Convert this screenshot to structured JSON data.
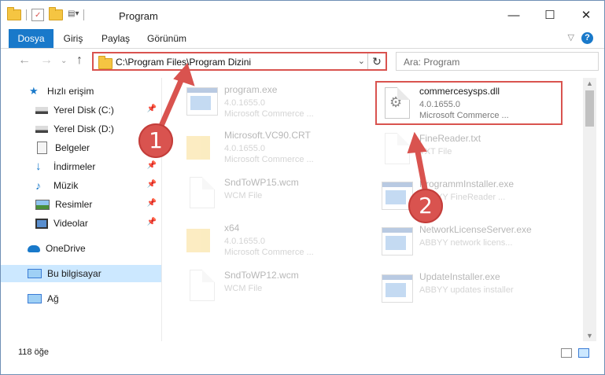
{
  "window": {
    "title": "Program",
    "controls": [
      "minimize",
      "maximize",
      "close"
    ]
  },
  "ribbon": {
    "tabs": [
      "Dosya",
      "Giriş",
      "Paylaş",
      "Görünüm"
    ]
  },
  "navigation": {
    "address_path": "C:\\Program Files\\Program Dizini",
    "search_placeholder": "Ara: Program"
  },
  "sidebar": {
    "items": [
      {
        "label": "Hızlı erişim",
        "icon": "star-icon",
        "pinned": false
      },
      {
        "label": "Yerel Disk (C:)",
        "icon": "drive-icon",
        "pinned": true
      },
      {
        "label": "Yerel Disk (D:)",
        "icon": "drive-icon",
        "pinned": false
      },
      {
        "label": "Belgeler",
        "icon": "documents-icon",
        "pinned": true
      },
      {
        "label": "İndirmeler",
        "icon": "download-icon",
        "pinned": true
      },
      {
        "label": "Müzik",
        "icon": "music-icon",
        "pinned": true
      },
      {
        "label": "Resimler",
        "icon": "pictures-icon",
        "pinned": true
      },
      {
        "label": "Videolar",
        "icon": "videos-icon",
        "pinned": true
      },
      {
        "label": "OneDrive",
        "icon": "cloud-icon",
        "pinned": false
      },
      {
        "label": "Bu bilgisayar",
        "icon": "computer-icon",
        "pinned": false,
        "selected": true
      },
      {
        "label": "Ağ",
        "icon": "network-icon",
        "pinned": false
      }
    ]
  },
  "files": [
    {
      "name": "program.exe",
      "line2": "4.0.1655.0",
      "line3": "Microsoft Commerce ...",
      "icon": "app-icon",
      "faded": true
    },
    {
      "name": "commercesysps.dll",
      "line2": "4.0.1655.0",
      "line3": "Microsoft Commerce ...",
      "icon": "dll-gear-icon",
      "faded": false
    },
    {
      "name": "Microsoft.VC90.CRT",
      "line2": "4.0.1655.0",
      "line3": "Microsoft Commerce ...",
      "icon": "folder-icon",
      "faded": true
    },
    {
      "name": "FineReader.txt",
      "line2": "TXT File",
      "line3": "",
      "icon": "text-file-icon",
      "faded": true
    },
    {
      "name": "SndToWP15.wcm",
      "line2": "WCM File",
      "line3": "",
      "icon": "file-icon",
      "faded": true
    },
    {
      "name": "ProgrammInstaller.exe",
      "line2": "ABBYY FineReader ...",
      "line3": "",
      "icon": "app-icon",
      "faded": true
    },
    {
      "name": "x64",
      "line2": "4.0.1655.0",
      "line3": "Microsoft Commerce ...",
      "icon": "folder-icon",
      "faded": true
    },
    {
      "name": "NetworkLicenseServer.exe",
      "line2": "ABBYY network licens...",
      "line3": "",
      "icon": "app-icon",
      "faded": true
    },
    {
      "name": "SndToWP12.wcm",
      "line2": "WCM File",
      "line3": "",
      "icon": "file-icon",
      "faded": true
    },
    {
      "name": "UpdateInstaller.exe",
      "line2": "ABBYY updates installer",
      "line3": "",
      "icon": "app-icon",
      "faded": true
    }
  ],
  "status": {
    "item_count": "118 öğe"
  },
  "annotations": {
    "step1": "1",
    "step2": "2",
    "accent": "#d9534f"
  }
}
